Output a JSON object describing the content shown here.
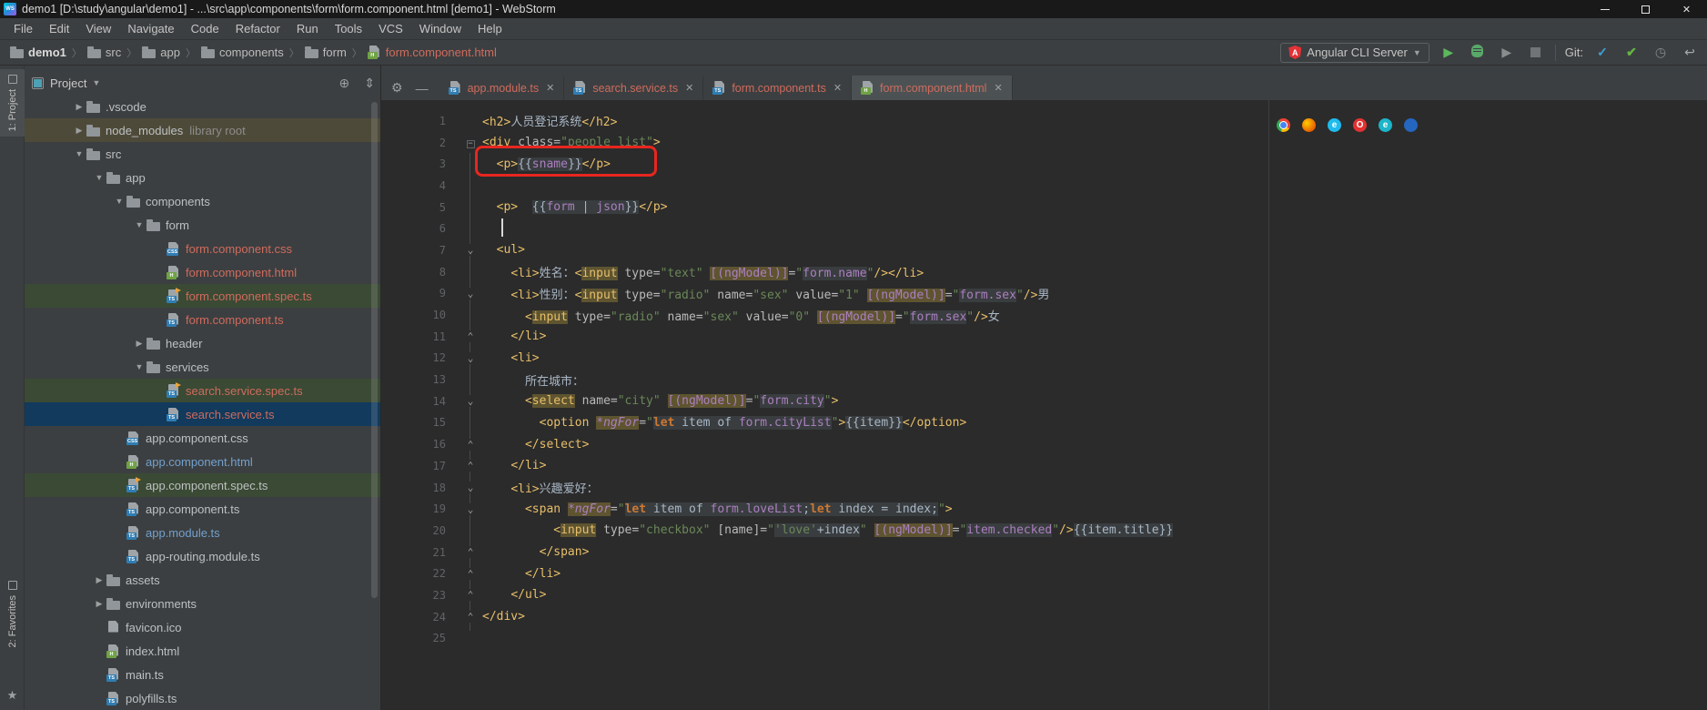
{
  "window": {
    "title": "demo1 [D:\\study\\angular\\demo1] - ...\\src\\app\\components\\form\\form.component.html [demo1] - WebStorm",
    "logo": "WS",
    "controls": {
      "minimize": "minimize",
      "restore": "restore",
      "close": "✕"
    }
  },
  "menu": {
    "items": [
      "File",
      "Edit",
      "View",
      "Navigate",
      "Code",
      "Refactor",
      "Run",
      "Tools",
      "VCS",
      "Window",
      "Help"
    ]
  },
  "toolbar": {
    "breadcrumbs": [
      {
        "label": "demo1",
        "icon": "folder",
        "style": "bold"
      },
      {
        "label": "src",
        "icon": "folder"
      },
      {
        "label": "app",
        "icon": "folder"
      },
      {
        "label": "components",
        "icon": "folder"
      },
      {
        "label": "form",
        "icon": "folder"
      },
      {
        "label": "form.component.html",
        "icon": "html",
        "style": "file-red"
      }
    ],
    "run_config": {
      "label": "Angular CLI Server"
    },
    "git_label": "Git:"
  },
  "left_stripe": {
    "top_tab": "1: Project",
    "bottom_tab": "2: Favorites",
    "star": "★"
  },
  "project_panel": {
    "header": {
      "label": "Project"
    },
    "tree": [
      {
        "label": ".vscode",
        "icon": "folder",
        "arrow": "right",
        "lvl": 1
      },
      {
        "label": "node_modules",
        "suffix": "library root",
        "icon": "folder",
        "arrow": "right",
        "lvl": 1,
        "row": "olive"
      },
      {
        "label": "src",
        "icon": "folder",
        "arrow": "down",
        "lvl": 1
      },
      {
        "label": "app",
        "icon": "folder",
        "arrow": "down",
        "lvl": 2
      },
      {
        "label": "components",
        "icon": "folder",
        "arrow": "down",
        "lvl": 3
      },
      {
        "label": "form",
        "icon": "folder",
        "arrow": "down",
        "lvl": 4
      },
      {
        "label": "form.component.css",
        "icon": "css",
        "lvl": 5,
        "color": "red"
      },
      {
        "label": "form.component.html",
        "icon": "html",
        "lvl": 5,
        "color": "red"
      },
      {
        "label": "form.component.spec.ts",
        "icon": "ts-spec",
        "lvl": 5,
        "color": "red",
        "row": "green"
      },
      {
        "label": "form.component.ts",
        "icon": "ts",
        "lvl": 5,
        "color": "red"
      },
      {
        "label": "header",
        "icon": "folder",
        "arrow": "right",
        "lvl": 4
      },
      {
        "label": "services",
        "icon": "folder",
        "arrow": "down",
        "lvl": 4
      },
      {
        "label": "search.service.spec.ts",
        "icon": "ts-spec",
        "lvl": 5,
        "color": "red",
        "row": "green"
      },
      {
        "label": "search.service.ts",
        "icon": "ts",
        "lvl": 5,
        "color": "red",
        "row": "selected"
      },
      {
        "label": "app.component.css",
        "icon": "css",
        "lvl": 3
      },
      {
        "label": "app.component.html",
        "icon": "html",
        "lvl": 3,
        "color": "blue"
      },
      {
        "label": "app.component.spec.ts",
        "icon": "ts-spec",
        "lvl": 3,
        "row": "green"
      },
      {
        "label": "app.component.ts",
        "icon": "ts",
        "lvl": 3
      },
      {
        "label": "app.module.ts",
        "icon": "ts",
        "lvl": 3,
        "color": "blue"
      },
      {
        "label": "app-routing.module.ts",
        "icon": "ts",
        "lvl": 3
      },
      {
        "label": "assets",
        "icon": "folder",
        "arrow": "right",
        "lvl": 2
      },
      {
        "label": "environments",
        "icon": "folder",
        "arrow": "right",
        "lvl": 2
      },
      {
        "label": "favicon.ico",
        "icon": "page",
        "lvl": 2
      },
      {
        "label": "index.html",
        "icon": "html",
        "lvl": 2
      },
      {
        "label": "main.ts",
        "icon": "ts",
        "lvl": 2
      },
      {
        "label": "polyfills.ts",
        "icon": "ts",
        "lvl": 2
      }
    ]
  },
  "tabs": [
    {
      "label": "app.module.ts",
      "icon": "ts"
    },
    {
      "label": "search.service.ts",
      "icon": "ts"
    },
    {
      "label": "form.component.ts",
      "icon": "ts"
    },
    {
      "label": "form.component.html",
      "icon": "html",
      "active": true
    }
  ],
  "editor": {
    "folds": {
      "2": "box",
      "7": "open",
      "9": "open",
      "11": "close",
      "12": "open",
      "14": "open",
      "16": "close",
      "17": "close",
      "18": "open",
      "19": "open",
      "21": "close",
      "22": "close",
      "23": "close",
      "24": "close"
    },
    "browser_icons": [
      {
        "name": "chrome-icon",
        "cls": "b-chrome",
        "glyph": ""
      },
      {
        "name": "firefox-icon",
        "cls": "b-firefox",
        "glyph": ""
      },
      {
        "name": "ie-icon",
        "cls": "b-ie",
        "glyph": "e"
      },
      {
        "name": "opera-icon",
        "cls": "b-opera",
        "glyph": "O"
      },
      {
        "name": "edge-icon",
        "cls": "b-edge",
        "glyph": "e"
      },
      {
        "name": "safari-icon",
        "cls": "b-safari",
        "glyph": ""
      }
    ],
    "lines": [
      {
        "n": 1,
        "ind": 0,
        "tk": [
          [
            "g",
            "<h2>"
          ],
          [
            "t",
            "人员登记系统"
          ],
          [
            "g",
            "</h2>"
          ]
        ]
      },
      {
        "n": 2,
        "ind": 0,
        "tk": [
          [
            "g",
            "<div "
          ],
          [
            "a",
            "class"
          ],
          [
            "a",
            "="
          ],
          [
            "s",
            "\"people_list\""
          ],
          [
            "g",
            ">"
          ]
        ]
      },
      {
        "n": 3,
        "ind": 2,
        "tk": [
          [
            "g",
            "<p>"
          ],
          [
            "w fr",
            "{{"
          ],
          [
            "p fr",
            "sname"
          ],
          [
            "w fr",
            "}}"
          ],
          [
            "g",
            "</p>"
          ]
        ]
      },
      {
        "n": 4,
        "ind": 0,
        "tk": []
      },
      {
        "n": 5,
        "ind": 2,
        "tk": [
          [
            "g",
            "<p>"
          ],
          [
            "w",
            "  "
          ],
          [
            "w fr",
            "{{"
          ],
          [
            "p fr",
            "form"
          ],
          [
            "w fr",
            " | "
          ],
          [
            "p fr",
            "json"
          ],
          [
            "w fr",
            "}}"
          ],
          [
            "g",
            "</p>"
          ]
        ]
      },
      {
        "n": 6,
        "ind": 0,
        "tk": []
      },
      {
        "n": 7,
        "ind": 2,
        "tk": [
          [
            "g",
            "<ul>"
          ]
        ]
      },
      {
        "n": 8,
        "ind": 4,
        "tk": [
          [
            "g",
            "<li>"
          ],
          [
            "t",
            "姓名："
          ],
          [
            "g",
            "<"
          ],
          [
            "g hl",
            "input"
          ],
          [
            "w",
            " "
          ],
          [
            "a",
            "type"
          ],
          [
            "a",
            "="
          ],
          [
            "s",
            "\"text\""
          ],
          [
            "w",
            " "
          ],
          [
            "p hl",
            "[(ngModel)]"
          ],
          [
            "a",
            "="
          ],
          [
            "s",
            "\""
          ],
          [
            "p fr",
            "form.name"
          ],
          [
            "s",
            "\""
          ],
          [
            "g",
            "/></li>"
          ]
        ]
      },
      {
        "n": 9,
        "ind": 4,
        "tk": [
          [
            "g",
            "<li>"
          ],
          [
            "t",
            "性别："
          ],
          [
            "g",
            "<"
          ],
          [
            "g hl",
            "input"
          ],
          [
            "w",
            " "
          ],
          [
            "a",
            "type"
          ],
          [
            "a",
            "="
          ],
          [
            "s",
            "\"radio\""
          ],
          [
            "w",
            " "
          ],
          [
            "a",
            "name"
          ],
          [
            "a",
            "="
          ],
          [
            "s",
            "\"sex\""
          ],
          [
            "w",
            " "
          ],
          [
            "a",
            "value"
          ],
          [
            "a",
            "="
          ],
          [
            "s",
            "\"1\""
          ],
          [
            "w",
            " "
          ],
          [
            "p hl",
            "[(ngModel)]"
          ],
          [
            "a",
            "="
          ],
          [
            "s",
            "\""
          ],
          [
            "p fr",
            "form.sex"
          ],
          [
            "s",
            "\""
          ],
          [
            "g",
            "/>"
          ],
          [
            "t",
            "男"
          ]
        ]
      },
      {
        "n": 10,
        "ind": 6,
        "tk": [
          [
            "g",
            "<"
          ],
          [
            "g hl",
            "input"
          ],
          [
            "w",
            " "
          ],
          [
            "a",
            "type"
          ],
          [
            "a",
            "="
          ],
          [
            "s",
            "\"radio\""
          ],
          [
            "w",
            " "
          ],
          [
            "a",
            "name"
          ],
          [
            "a",
            "="
          ],
          [
            "s",
            "\"sex\""
          ],
          [
            "w",
            " "
          ],
          [
            "a",
            "value"
          ],
          [
            "a",
            "="
          ],
          [
            "s",
            "\"0\""
          ],
          [
            "w",
            " "
          ],
          [
            "p hl",
            "[(ngModel)]"
          ],
          [
            "a",
            "="
          ],
          [
            "s",
            "\""
          ],
          [
            "p fr",
            "form.sex"
          ],
          [
            "s",
            "\""
          ],
          [
            "g",
            "/>"
          ],
          [
            "t",
            "女"
          ]
        ]
      },
      {
        "n": 11,
        "ind": 4,
        "tk": [
          [
            "g",
            "</li>"
          ]
        ]
      },
      {
        "n": 12,
        "ind": 4,
        "tk": [
          [
            "g",
            "<li>"
          ]
        ]
      },
      {
        "n": 13,
        "ind": 6,
        "tk": [
          [
            "t",
            "所在城市："
          ]
        ]
      },
      {
        "n": 14,
        "ind": 6,
        "tk": [
          [
            "g",
            "<"
          ],
          [
            "g hl",
            "select"
          ],
          [
            "w",
            " "
          ],
          [
            "a",
            "name"
          ],
          [
            "a",
            "="
          ],
          [
            "s",
            "\"city\""
          ],
          [
            "w",
            " "
          ],
          [
            "p hl",
            "[(ngModel)]"
          ],
          [
            "a",
            "="
          ],
          [
            "s",
            "\""
          ],
          [
            "p fr",
            "form.city"
          ],
          [
            "s",
            "\""
          ],
          [
            "g",
            ">"
          ]
        ]
      },
      {
        "n": 15,
        "ind": 8,
        "tk": [
          [
            "g",
            "<option "
          ],
          [
            "d hl",
            "*ngFor"
          ],
          [
            "a",
            "="
          ],
          [
            "s",
            "\""
          ],
          [
            "k fr",
            "let"
          ],
          [
            "w fr",
            " item of "
          ],
          [
            "p fr",
            "form.cityList"
          ],
          [
            "s",
            "\""
          ],
          [
            "g",
            ">"
          ],
          [
            "w fr",
            "{{item}}"
          ],
          [
            "g",
            "</option>"
          ]
        ]
      },
      {
        "n": 16,
        "ind": 6,
        "tk": [
          [
            "g",
            "</select>"
          ]
        ]
      },
      {
        "n": 17,
        "ind": 4,
        "tk": [
          [
            "g",
            "</li>"
          ]
        ]
      },
      {
        "n": 18,
        "ind": 4,
        "tk": [
          [
            "g",
            "<li>"
          ],
          [
            "t",
            "兴趣爱好："
          ]
        ]
      },
      {
        "n": 19,
        "ind": 6,
        "tk": [
          [
            "g",
            "<span "
          ],
          [
            "d hl",
            "*ngFor"
          ],
          [
            "a",
            "="
          ],
          [
            "s",
            "\""
          ],
          [
            "k fr",
            "let"
          ],
          [
            "w fr",
            " item of "
          ],
          [
            "p fr",
            "form.loveList"
          ],
          [
            "w fr",
            ";"
          ],
          [
            "k fr",
            "let"
          ],
          [
            "w fr",
            " index = index;"
          ],
          [
            "s",
            "\""
          ],
          [
            "g",
            ">"
          ]
        ]
      },
      {
        "n": 20,
        "ind": 10,
        "tk": [
          [
            "g",
            "<"
          ],
          [
            "g hl",
            "input"
          ],
          [
            "w",
            " "
          ],
          [
            "a",
            "type"
          ],
          [
            "a",
            "="
          ],
          [
            "s",
            "\"checkbox\""
          ],
          [
            "w",
            " "
          ],
          [
            "a",
            "[name]"
          ],
          [
            "a",
            "="
          ],
          [
            "s",
            "\""
          ],
          [
            "s fr",
            "'love'"
          ],
          [
            "w fr",
            "+index"
          ],
          [
            "s",
            "\""
          ],
          [
            "w",
            " "
          ],
          [
            "p hl",
            "[(ngModel)]"
          ],
          [
            "a",
            "="
          ],
          [
            "s",
            "\""
          ],
          [
            "p fr",
            "item.checked"
          ],
          [
            "s",
            "\""
          ],
          [
            "g",
            "/>"
          ],
          [
            "w fr",
            "{{item.title}}"
          ]
        ]
      },
      {
        "n": 21,
        "ind": 8,
        "tk": [
          [
            "g",
            "</span>"
          ]
        ]
      },
      {
        "n": 22,
        "ind": 6,
        "tk": [
          [
            "g",
            "</li>"
          ]
        ]
      },
      {
        "n": 23,
        "ind": 4,
        "tk": [
          [
            "g",
            "</ul>"
          ]
        ]
      },
      {
        "n": 24,
        "ind": 0,
        "tk": [
          [
            "g",
            "</div>"
          ]
        ]
      },
      {
        "n": 25,
        "ind": 0,
        "tk": []
      }
    ]
  }
}
